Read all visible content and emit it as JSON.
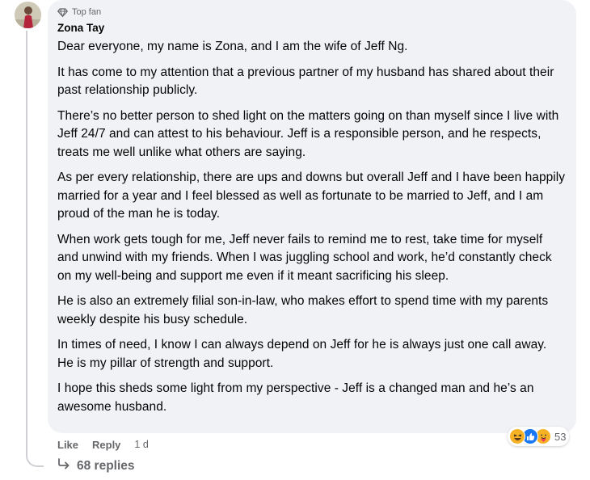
{
  "comment": {
    "badge": "Top fan",
    "author": "Zona Tay",
    "paragraphs": [
      "Dear everyone, my name is Zona, and I am the wife of Jeff Ng.",
      "It has come to my attention that a previous partner of my husband has shared about their past relationship publicly.",
      "There’s no better person to shed light on the matters going on than myself since I live with Jeff 24/7 and can attest to his behaviour. Jeff is a responsible person, and he respects, treats me well unlike what others are saying.",
      "As per every relationship, there are ups and downs but overall Jeff and I have been happily married for a year and I feel blessed as well as fortunate to be married to Jeff, and I am proud of the man he is today.",
      "When work gets tough for me, Jeff never fails to remind me to rest, take time for myself and unwind with my friends. When I was juggling school and work, he’d constantly check on my well-being and support me even if it meant sacrificing his sleep.",
      "He is also an extremely filial son-in-law, who makes effort to spend time with my parents weekly despite his busy schedule.",
      "In times of need, I know I can always depend on Jeff for he is always just one call away. He is my pillar of strength and support.",
      "I hope this sheds some light from my perspective - Jeff is a changed man and he’s an awesome husband."
    ]
  },
  "actions": {
    "like": "Like",
    "reply": "Reply",
    "timestamp": "1 d"
  },
  "reactions": {
    "icons": [
      "haha-icon",
      "like-icon",
      "care-icon"
    ],
    "count": "53"
  },
  "replies": {
    "label": "68 replies"
  },
  "colors": {
    "bubble": "#f0f2f5",
    "secondary_text": "#65676b",
    "like_blue": "#1877f2",
    "haha_yellow": "#f7b125"
  }
}
